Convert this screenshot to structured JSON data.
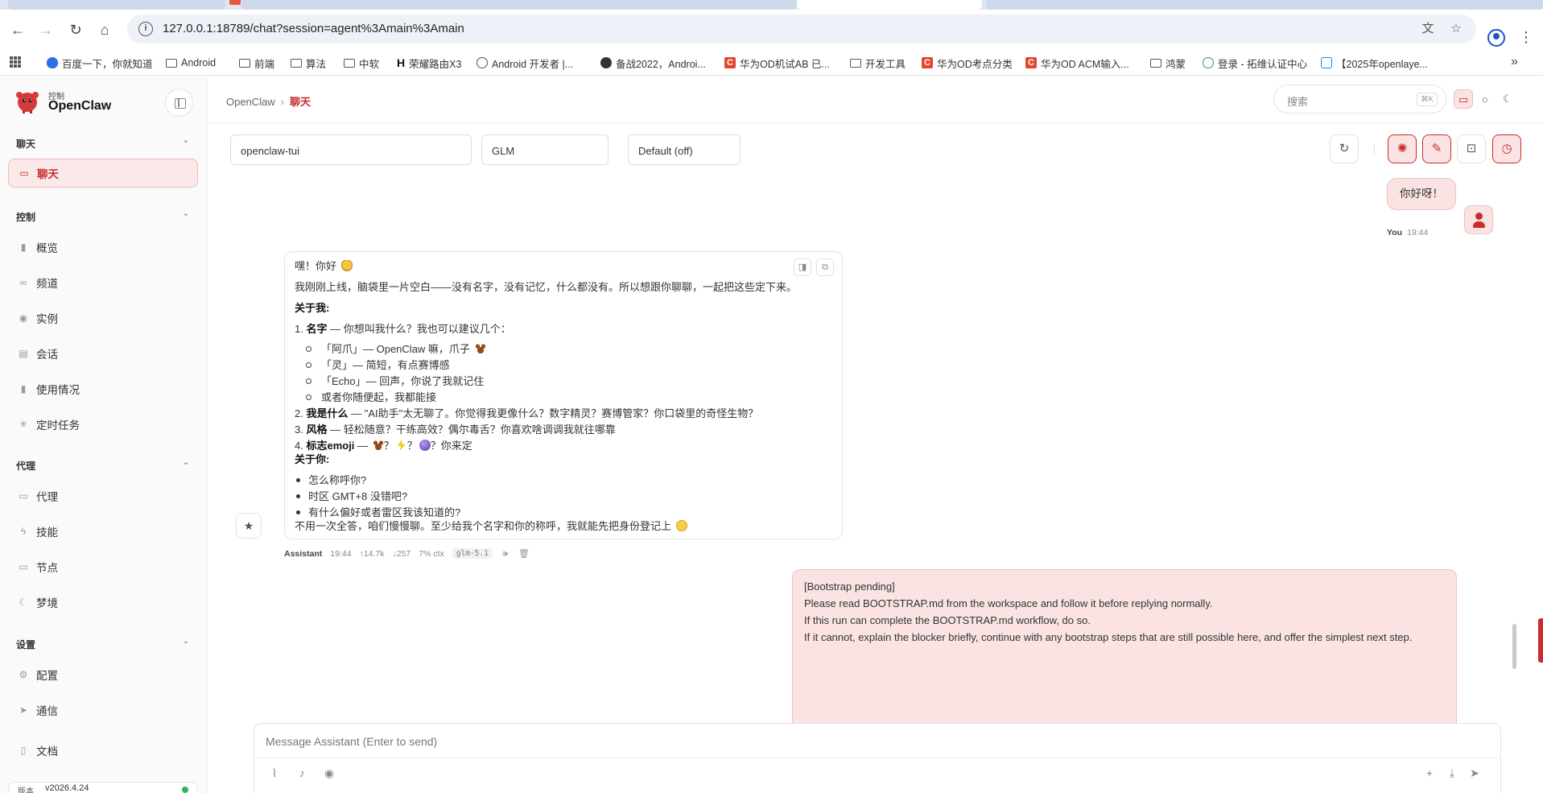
{
  "browser": {
    "url": "127.0.0.1:18789/chat?session=agent%3Amain%3Amain",
    "bookmarks": [
      {
        "label": "百度一下，你就知道",
        "icon": "baidu-paw-icon"
      },
      {
        "label": "Android",
        "icon": "folder-icon"
      },
      {
        "label": "前端",
        "icon": "folder-icon"
      },
      {
        "label": "算法",
        "icon": "folder-icon"
      },
      {
        "label": "中软",
        "icon": "folder-icon"
      },
      {
        "label": "荣耀路由X3",
        "icon": "h-logo-icon"
      },
      {
        "label": "Android 开发者  |...",
        "icon": "globe-icon"
      },
      {
        "label": "备战2022，Androi...",
        "icon": "site-icon"
      },
      {
        "label": "华为OD机试AB 已...",
        "icon": "csdn-c-icon"
      },
      {
        "label": "开发工具",
        "icon": "folder-icon"
      },
      {
        "label": "华为OD考点分类",
        "icon": "csdn-c-icon"
      },
      {
        "label": "华为OD ACM输入...",
        "icon": "csdn-c-icon"
      },
      {
        "label": "鸿蒙",
        "icon": "folder-icon"
      },
      {
        "label": "登录 - 拓维认证中心",
        "icon": "login-icon"
      },
      {
        "label": "【2025年openlaye...",
        "icon": "bilibili-tv-icon"
      }
    ]
  },
  "sidebar": {
    "brand_sub": "控制",
    "brand_name": "OpenClaw",
    "sections": {
      "chat": "聊天",
      "control": "控制",
      "agent": "代理",
      "settings": "设置"
    },
    "items": {
      "chat": "聊天",
      "overview": "概览",
      "channels": "频道",
      "instances": "实例",
      "sessions": "会话",
      "usage": "使用情况",
      "cron": "定时任务",
      "agents": "代理",
      "skills": "技能",
      "nodes": "节点",
      "dreams": "梦境",
      "config": "配置",
      "comms": "通信",
      "docs": "文档"
    },
    "version_label": "版本",
    "version_value": "v2026.4.24"
  },
  "topbar": {
    "crumb_root": "OpenClaw",
    "crumb_current": "聊天",
    "search_placeholder": "搜索",
    "search_kbd": "⌘K"
  },
  "controls": {
    "session": "openclaw-tui",
    "model": "GLM",
    "thinking": "Default (off)"
  },
  "user_message": {
    "text": "你好呀！",
    "author": "You",
    "time": "19:44"
  },
  "assistant_message": {
    "greeting": "嘿！你好",
    "intro": "我刚刚上线，脑袋里一片空白——没有名字，没有记忆，什么都没有。所以想跟你聊聊，一起把这些定下来。",
    "about_me": "关于我:",
    "item1_title": "名字",
    "item1_text": " — 你想叫我什么？我也可以建议几个：",
    "sub1": "「阿爪」— OpenClaw 嘛，爪子",
    "sub2": "「灵」— 简短，有点赛博感",
    "sub3": "「Echo」— 回声，你说了我就记住",
    "sub4": "或者你随便起，我都能接",
    "item2_title": "我是什么",
    "item2_text": " — \"AI助手\"太无聊了。你觉得我更像什么？数字精灵？赛博管家？你口袋里的奇怪生物？",
    "item3_title": "风格",
    "item3_text": " — 轻松随意？干练高效？偶尔毒舌？你喜欢啥调调我就往哪靠",
    "item4_title": "标志emoji",
    "item4_text_a": " — ",
    "item4_q1": "？",
    "item4_q2": "？",
    "item4_q3": "？你来定",
    "about_you": "关于你:",
    "bullet1": "怎么称呼你?",
    "bullet2": "时区 GMT+8 没错吧?",
    "bullet3": "有什么偏好或者雷区我该知道的?",
    "closing": "不用一次全答，咱们慢慢聊。至少给我个名字和你的称呼，我就能先把身份登记上",
    "author": "Assistant",
    "time": "19:44",
    "tokens_up": "↑14.7k",
    "tokens_down": "↓257",
    "ctx": "7% ctx",
    "model": "glm-5.1"
  },
  "system_message": {
    "line1": "[Bootstrap pending]",
    "line2": "Please read BOOTSTRAP.md from the workspace and follow it before replying normally.",
    "line3": "If this run can complete the BOOTSTRAP.md workflow, do so.",
    "line4": "If it cannot, explain the blocker briefly, continue with any bootstrap steps that are still possible here, and offer the simplest next step."
  },
  "composer": {
    "placeholder": "Message Assistant (Enter to send)"
  },
  "colors": {
    "accent": "#c62d2d",
    "accent_bg": "#fbe3e3"
  }
}
